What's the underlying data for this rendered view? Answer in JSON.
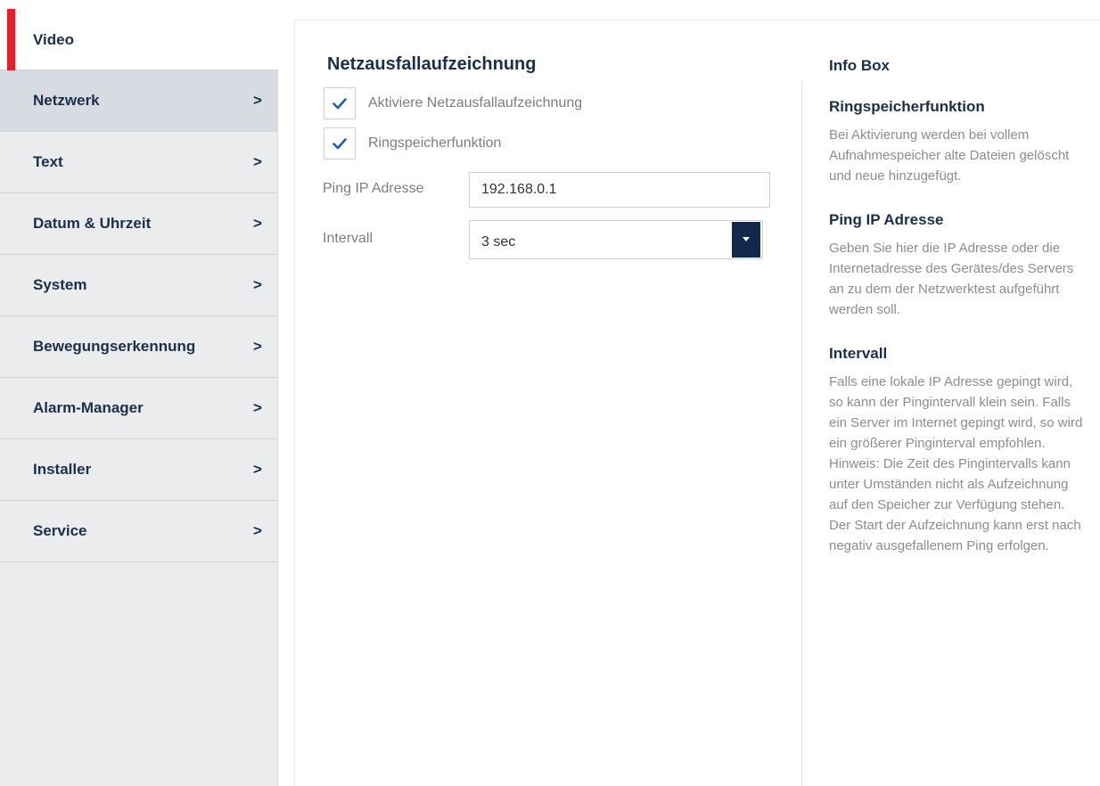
{
  "sidebar": {
    "items": [
      {
        "label": "Video",
        "chevron": ""
      },
      {
        "label": "Netzwerk",
        "chevron": ">"
      },
      {
        "label": "Text",
        "chevron": ">"
      },
      {
        "label": "Datum & Uhrzeit",
        "chevron": ">"
      },
      {
        "label": "System",
        "chevron": ">"
      },
      {
        "label": "Bewegungserkennung",
        "chevron": ">"
      },
      {
        "label": "Alarm-Manager",
        "chevron": ">"
      },
      {
        "label": "Installer",
        "chevron": ">"
      },
      {
        "label": "Service",
        "chevron": ">"
      }
    ]
  },
  "main": {
    "title": "Netzausfallaufzeichnung",
    "checkboxes": [
      {
        "label": "Aktiviere Netzausfallaufzeichnung",
        "checked": true
      },
      {
        "label": "Ringspeicherfunktion",
        "checked": true
      }
    ],
    "ping": {
      "label": "Ping IP Adresse",
      "value": "192.168.0.1"
    },
    "interval": {
      "label": "Intervall",
      "value": "3 sec"
    }
  },
  "info": {
    "title": "Info Box",
    "sections": [
      {
        "heading": "Ringspeicherfunktion",
        "text": "Bei Aktivierung werden bei vollem Aufnahmespeicher alte Dateien gelöscht und neue hinzugefügt."
      },
      {
        "heading": "Ping IP Adresse",
        "text": "Geben Sie hier die IP Adresse oder die Internetadresse des Gerätes/des Servers an zu dem der Netzwerktest aufgeführt werden soll."
      },
      {
        "heading": "Intervall",
        "text": "Falls eine lokale IP Adresse gepingt wird, so kann der Pingintervall klein sein. Falls ein Server im Internet gepingt wird, so wird ein größerer Pinginterval empfohlen. Hinweis: Die Zeit des Pingintervalls kann unter Umständen nicht als Aufzeichnung auf den Speicher zur Verfügung stehen. Der Start der Aufzeichnung kann erst nach negativ ausgefallenem Ping erfolgen."
      }
    ]
  },
  "colors": {
    "accent": "#e2202b",
    "navy": "#13294b",
    "sidebar_bg": "#ebecee"
  }
}
